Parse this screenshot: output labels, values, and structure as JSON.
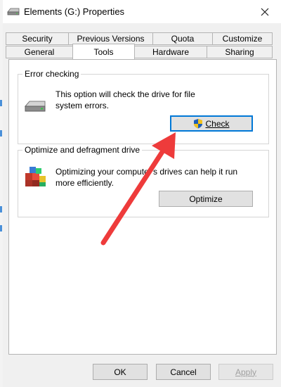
{
  "window": {
    "title": "Elements (G:) Properties"
  },
  "tabs": {
    "top_row": [
      "Security",
      "Previous Versions",
      "Quota",
      "Customize"
    ],
    "bottom_row": [
      "General",
      "Tools",
      "Hardware",
      "Sharing"
    ],
    "active": "Tools"
  },
  "error_checking": {
    "title": "Error checking",
    "description_line1": "This option will check the drive for file",
    "description_line2": "system errors.",
    "button": "Check"
  },
  "optimize": {
    "title": "Optimize and defragment drive",
    "description_line1": "Optimizing your computer's drives can help it run",
    "description_line2": "more efficiently.",
    "button": "Optimize"
  },
  "footer": {
    "ok": "OK",
    "cancel": "Cancel",
    "apply": "Apply"
  },
  "annotation": {
    "arrow_color": "#ee3b3b"
  },
  "icons": [
    "drive-icon",
    "close-icon",
    "shield-icon",
    "defrag-icon",
    "red-arrow-annotation"
  ]
}
